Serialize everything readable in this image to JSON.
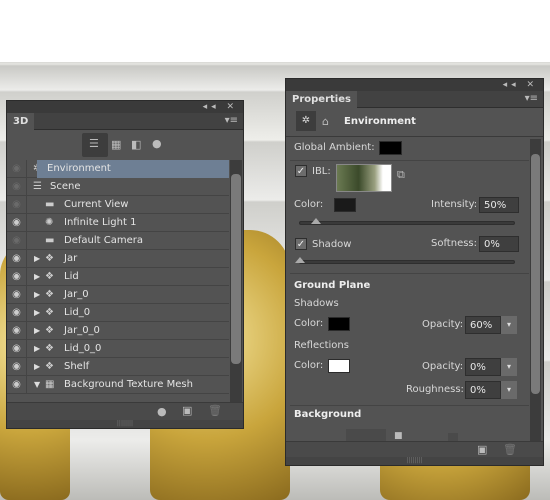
{
  "panel_3d": {
    "tab": "3D",
    "title_controls": "◂◂ ✕",
    "menu_icon": "panel-menu-icon",
    "filter_icons": [
      "scene-filter-icon",
      "mesh-filter-icon",
      "material-filter-icon",
      "light-filter-icon"
    ],
    "layers": [
      {
        "label": "Environment",
        "icon": "environment-icon",
        "visible": false,
        "selected": true,
        "indent": 0,
        "expander": ""
      },
      {
        "label": "Scene",
        "icon": "scene-icon",
        "visible": false,
        "indent": 0,
        "expander": ""
      },
      {
        "label": "Current View",
        "icon": "camera-icon",
        "visible": false,
        "indent": 1,
        "expander": ""
      },
      {
        "label": "Infinite Light 1",
        "icon": "infinite-light-icon",
        "visible": true,
        "indent": 1,
        "expander": ""
      },
      {
        "label": "Default Camera",
        "icon": "camera-icon",
        "visible": false,
        "indent": 1,
        "expander": ""
      },
      {
        "label": "Jar",
        "icon": "mesh-icon",
        "visible": true,
        "indent": 1,
        "expander": "▶"
      },
      {
        "label": "Lid",
        "icon": "mesh-icon",
        "visible": true,
        "indent": 1,
        "expander": "▶"
      },
      {
        "label": "Jar_0",
        "icon": "mesh-icon",
        "visible": true,
        "indent": 1,
        "expander": "▶"
      },
      {
        "label": "Lid_0",
        "icon": "mesh-icon",
        "visible": true,
        "indent": 1,
        "expander": "▶"
      },
      {
        "label": "Jar_0_0",
        "icon": "mesh-icon",
        "visible": true,
        "indent": 1,
        "expander": "▶"
      },
      {
        "label": "Lid_0_0",
        "icon": "mesh-icon",
        "visible": true,
        "indent": 1,
        "expander": "▶"
      },
      {
        "label": "Shelf",
        "icon": "mesh-icon",
        "visible": true,
        "indent": 1,
        "expander": "▶"
      },
      {
        "label": "Background Texture Mesh",
        "icon": "plane-mesh-icon",
        "visible": true,
        "indent": 1,
        "expander": "▼"
      }
    ]
  },
  "properties": {
    "tab": "Properties",
    "header": "Environment",
    "global_ambient_label": "Global Ambient:",
    "global_ambient_color": "#000000",
    "ibl_label": "IBL:",
    "ibl_checked": true,
    "color_label": "Color:",
    "ibl_color": "#1a1a1a",
    "intensity_label": "Intensity:",
    "intensity": "50%",
    "intensity_fraction": 0.12,
    "shadow_label": "Shadow",
    "shadow_checked": true,
    "softness_label": "Softness:",
    "softness": "0%",
    "softness_fraction": 0,
    "ground_plane": "Ground Plane",
    "shadows": "Shadows",
    "shadows_color": "#000000",
    "opacity_label": "Opacity:",
    "shadows_opacity": "60%",
    "reflections": "Reflections",
    "reflections_color": "#ffffff",
    "reflections_opacity": "0%",
    "roughness_label": "Roughness:",
    "roughness": "0%",
    "background": "Background"
  }
}
